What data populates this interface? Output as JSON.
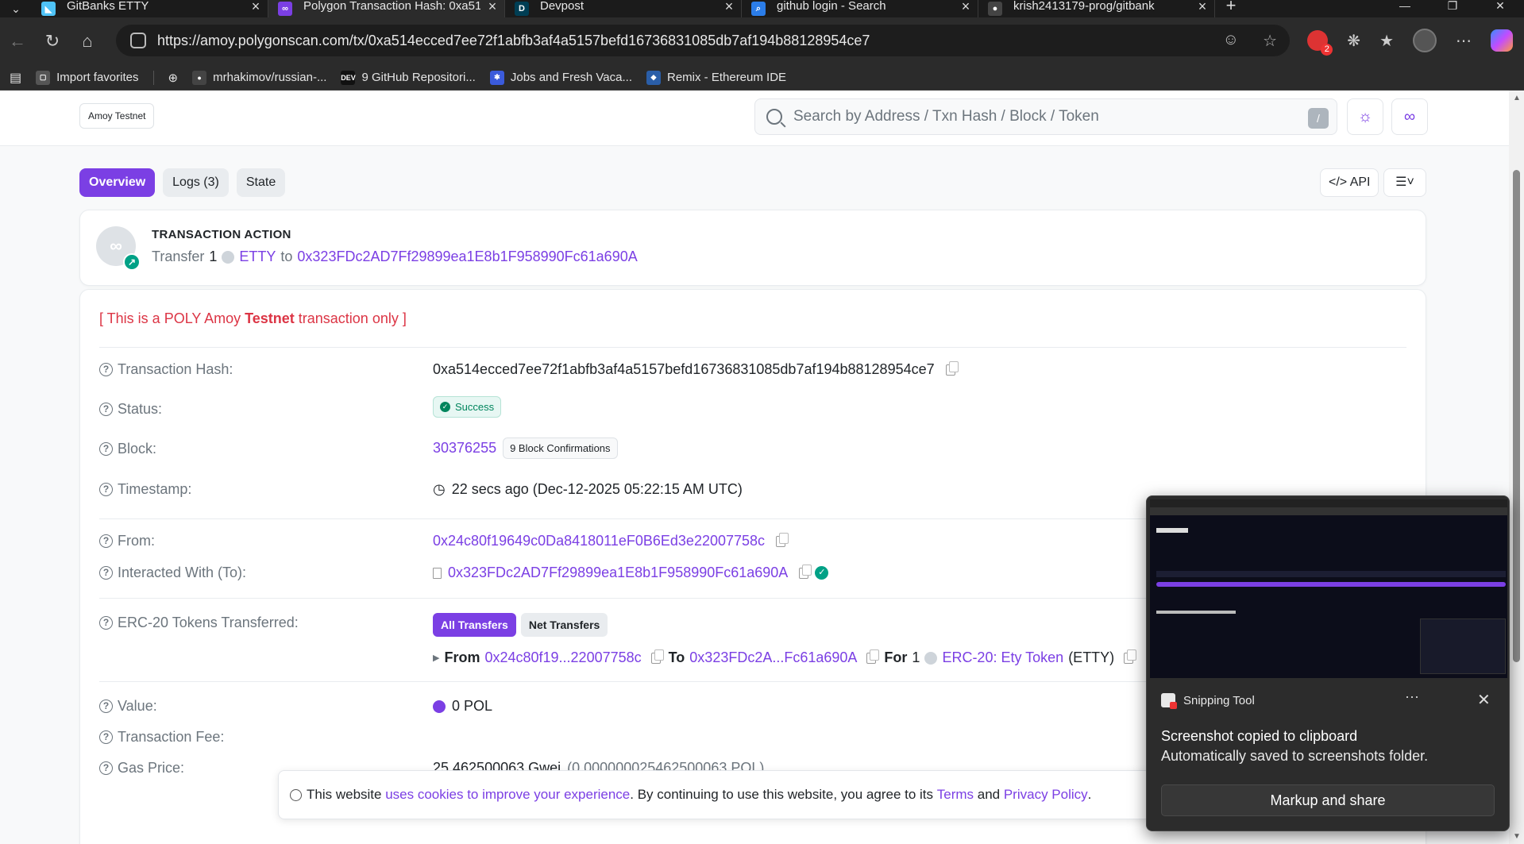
{
  "browser": {
    "tabs": [
      {
        "title": "GitBanks ETTY",
        "favicon": "flutter-icon",
        "color": "#4fc3f7",
        "glyph": "◣",
        "active": false
      },
      {
        "title": "Polygon Transaction Hash: 0xa51...",
        "favicon": "polygon-icon",
        "color": "#7b3fe4",
        "glyph": "∞",
        "active": true
      },
      {
        "title": "Devpost",
        "favicon": "devpost-icon",
        "color": "#003e54",
        "glyph": "D",
        "active": false
      },
      {
        "title": "github login - Search",
        "favicon": "bing-search-icon",
        "color": "#2b7de9",
        "glyph": "⌕",
        "active": false
      },
      {
        "title": "krish2413179-prog/gitbank",
        "favicon": "github-icon",
        "color": "#444",
        "glyph": "●",
        "active": false
      }
    ],
    "url": "https://amoy.polygonscan.com/tx/0xa514ecced7ee72f1abfb3af4a5157befd16736831085db7af194b88128954ce7",
    "bookmarks": [
      {
        "label": "Import favorites",
        "icon": "folder-icon",
        "color": "#555",
        "glyph": "▢"
      },
      {
        "label": "mrhakimov/russian-...",
        "icon": "github-icon",
        "color": "#444",
        "glyph": "●"
      },
      {
        "label": "9 GitHub Repositori...",
        "icon": "dev-icon",
        "color": "#111",
        "glyph": "DEV"
      },
      {
        "label": "Jobs and Fresh Vaca...",
        "icon": "jobs-icon",
        "color": "#3b5bdb",
        "glyph": "✱"
      },
      {
        "label": "Remix - Ethereum IDE",
        "icon": "remix-icon",
        "color": "#2a5ea8",
        "glyph": "◆"
      }
    ],
    "ext_badge": "2"
  },
  "header": {
    "network_badge": "Amoy Testnet",
    "search_placeholder": "Search by Address / Txn Hash / Block / Token",
    "search_shortcut": "/"
  },
  "tabs": {
    "overview": "Overview",
    "logs": "Logs (3)",
    "state": "State",
    "api": "</> API",
    "list": "☰˅"
  },
  "action": {
    "title": "TRANSACTION ACTION",
    "verb": "Transfer",
    "amount": "1",
    "token": "ETTY",
    "to_word": "to",
    "to_address": "0x323FDc2AD7Ff29899ea1E8b1F958990Fc61a690A"
  },
  "details": {
    "testnet_prefix": "[ This is a POLY Amoy ",
    "testnet_bold": "Testnet",
    "testnet_suffix": " transaction only ]",
    "hash_label": "Transaction Hash:",
    "hash_value": "0xa514ecced7ee72f1abfb3af4a5157befd16736831085db7af194b88128954ce7",
    "status_label": "Status:",
    "status_value": "Success",
    "block_label": "Block:",
    "block_value": "30376255",
    "block_confirmations": "9 Block Confirmations",
    "timestamp_label": "Timestamp:",
    "timestamp_value": "22 secs ago (Dec-12-2025 05:22:15 AM UTC)",
    "from_label": "From:",
    "from_value": "0x24c80f19649c0Da8418011eF0B6Ed3e22007758c",
    "to_label": "Interacted With (To):",
    "to_value": "0x323FDc2AD7Ff29899ea1E8b1F958990Fc61a690A",
    "erc20_label": "ERC-20 Tokens Transferred:",
    "all_transfers": "All Transfers",
    "net_transfers": "Net Transfers",
    "transfer_from_word": "From",
    "transfer_from": "0x24c80f19...22007758c",
    "transfer_to_word": "To",
    "transfer_to": "0x323FDc2A...Fc61a690A",
    "transfer_for_word": "For",
    "transfer_amount": "1",
    "transfer_token": "ERC-20: Ety Token",
    "transfer_symbol": "(ETTY)",
    "value_label": "Value:",
    "value_value": "0 POL",
    "fee_label": "Transaction Fee:",
    "gas_label": "Gas Price:",
    "gas_value": "25.462500063 Gwei",
    "gas_pol": "(0.000000025462500063 POL)"
  },
  "cookie": {
    "text1": "This website ",
    "link1": "uses cookies to improve your experience",
    "text2": ". By continuing to use this website, you agree to its ",
    "link2": "Terms",
    "text3": " and ",
    "link3": "Privacy Policy",
    "text4": "."
  },
  "toast": {
    "app": "Snipping Tool",
    "more": "···",
    "close": "✕",
    "title": "Screenshot copied to clipboard",
    "subtitle": "Automatically saved to screenshots folder.",
    "button": "Markup and share"
  },
  "colors": {
    "accent": "#7b3fe4",
    "success": "#00855d",
    "danger": "#dc3545"
  }
}
